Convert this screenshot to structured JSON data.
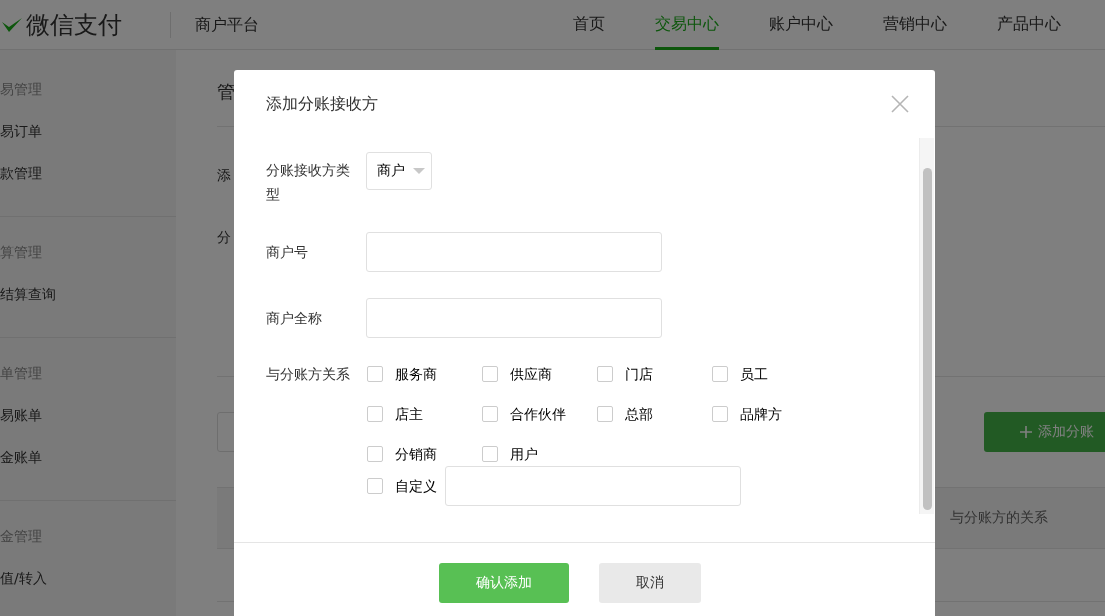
{
  "header": {
    "logo_text": "微信支付",
    "platform": "商户平台",
    "nav": [
      {
        "label": "首页",
        "selected": false
      },
      {
        "label": "交易中心",
        "selected": true
      },
      {
        "label": "账户中心",
        "selected": false
      },
      {
        "label": "营销中心",
        "selected": false
      },
      {
        "label": "产品中心",
        "selected": false
      }
    ]
  },
  "sidebar": {
    "groups": [
      {
        "title": "易管理",
        "items": [
          "易订单",
          "款管理"
        ]
      },
      {
        "title": "算管理",
        "items": [
          "结算查询"
        ]
      },
      {
        "title": "单管理",
        "items": [
          "易账单",
          "金账单"
        ]
      },
      {
        "title": "金管理",
        "items": [
          "值/转入"
        ]
      }
    ]
  },
  "content": {
    "title": "管",
    "labels": [
      "添",
      "分"
    ],
    "add_button": "添加分账",
    "table_columns": [
      "与分账方的关系"
    ]
  },
  "dialog": {
    "title": "添加分账接收方",
    "fields": [
      {
        "kind": "select",
        "label": "分账接收方类型",
        "value": "商户"
      },
      {
        "kind": "input",
        "label": "商户号"
      },
      {
        "kind": "input",
        "label": "商户全称"
      }
    ],
    "relation": {
      "label": "与分账方关系",
      "options": [
        {
          "label": "服务商",
          "checked": false
        },
        {
          "label": "供应商",
          "checked": false
        },
        {
          "label": "门店",
          "checked": false
        },
        {
          "label": "员工",
          "checked": false
        },
        {
          "label": "店主",
          "checked": false
        },
        {
          "label": "合作伙伴",
          "checked": false
        },
        {
          "label": "总部",
          "checked": false
        },
        {
          "label": "品牌方",
          "checked": false
        },
        {
          "label": "分销商",
          "checked": false
        },
        {
          "label": "用户",
          "checked": false
        }
      ],
      "custom": {
        "label": "自定义",
        "checked": false
      }
    },
    "buttons": [
      {
        "label": "确认添加",
        "kind": "primary"
      },
      {
        "label": "取消",
        "kind": "secondary"
      }
    ]
  }
}
